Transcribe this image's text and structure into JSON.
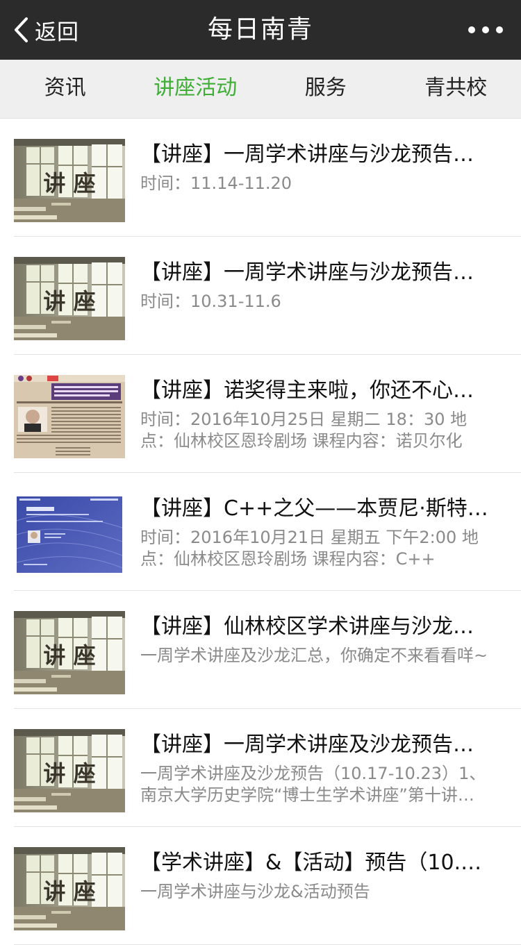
{
  "header": {
    "back_label": "返回",
    "title": "每日南青"
  },
  "tabs": [
    {
      "label": "资讯",
      "active": false
    },
    {
      "label": "讲座活动",
      "active": true
    },
    {
      "label": "服务",
      "active": false
    },
    {
      "label": "青共校",
      "active": false
    }
  ],
  "thumb_text": "讲 座",
  "colors": {
    "header_bg": "#2b2b2b",
    "tab_bg": "#efefef",
    "active_tab": "#3eae35",
    "desc_text": "#8a8a8a"
  },
  "items": [
    {
      "title": "【讲座】一周学术讲座与沙龙预告…",
      "desc": "时间：11.14-11.20",
      "thumb": "classroom"
    },
    {
      "title": "【讲座】一周学术讲座与沙龙预告…",
      "desc": "时间：10.31-11.6",
      "thumb": "classroom"
    },
    {
      "title": "【讲座】诺奖得主来啦，你还不心…",
      "desc": "时间：2016年10月25日 星期二 18：30 地点：仙林校区恩玲剧场 课程内容：诺贝尔化",
      "thumb": "poster-nobel"
    },
    {
      "title": "【讲座】C++之父——本贾尼·斯特…",
      "desc": "时间：2016年10月21日 星期五 下午2:00 地点：仙林校区恩玲剧场 课程内容：C++",
      "thumb": "poster-cpp"
    },
    {
      "title": "【讲座】仙林校区学术讲座与沙龙…",
      "desc": "一周学术讲座及沙龙汇总，你确定不来看看咩~",
      "thumb": "classroom"
    },
    {
      "title": "【讲座】一周学术讲座及沙龙预告…",
      "desc": "一周学术讲座及沙龙预告（10.17-10.23）1、南京大学历史学院“博士生学术讲座”第十讲…",
      "thumb": "classroom"
    },
    {
      "title": "【学术讲座】&【活动】预告（10.…",
      "desc": "一周学术讲座与沙龙&活动预告",
      "thumb": "classroom"
    }
  ]
}
